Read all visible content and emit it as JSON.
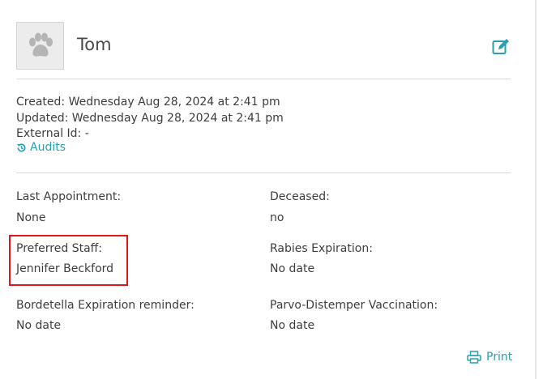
{
  "pet": {
    "name": "Tom",
    "avatar_icon": "paw-icon"
  },
  "header": {
    "edit_icon": "edit-icon"
  },
  "meta": {
    "created": "Created: Wednesday Aug 28, 2024 at 2:41 pm",
    "updated": "Updated: Wednesday Aug 28, 2024 at 2:41 pm",
    "external_id": "External Id: -",
    "audits_label": "Audits"
  },
  "fields": {
    "last_appointment": {
      "label": "Last Appointment:",
      "value": "None"
    },
    "deceased": {
      "label": "Deceased:",
      "value": "no"
    },
    "preferred_staff": {
      "label": "Preferred Staff:",
      "value": "Jennifer Beckford"
    },
    "rabies_expiration": {
      "label": "Rabies Expiration:",
      "value": "No date"
    },
    "bordetella": {
      "label": "Bordetella Expiration reminder:",
      "value": "No date"
    },
    "parvo": {
      "label": "Parvo-Distemper Vaccination:",
      "value": "No date"
    }
  },
  "footer": {
    "print_label": "Print"
  },
  "colors": {
    "accent": "#2a9fb0",
    "highlight": "#e3141a",
    "text": "#3d3d3d"
  }
}
